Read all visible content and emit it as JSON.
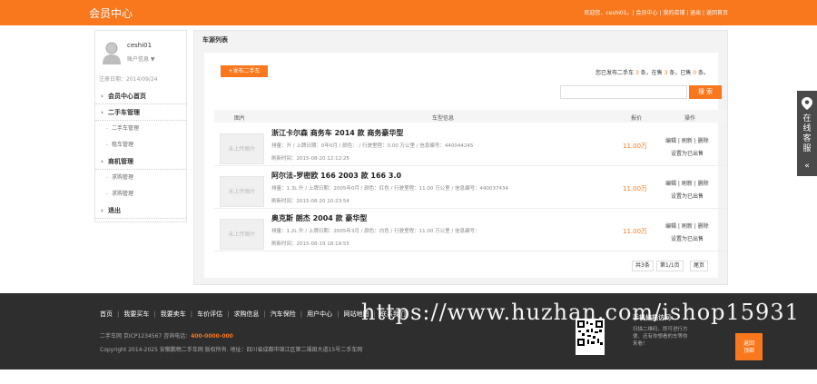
{
  "header": {
    "brand": "会员中心",
    "links": "欢迎您，ceshi01。| 会员中心 | 我的店铺 | 退出 | 返回首页"
  },
  "sidebar": {
    "username": "ceshi01",
    "account_info": "账户信息 ▼",
    "reg_date": "注册日期：2014/09/24",
    "items": [
      {
        "label": "会员中心首页",
        "type": "hd"
      },
      {
        "label": "二手车管理",
        "type": "hd"
      },
      {
        "label": "二手车管理",
        "type": "sub"
      },
      {
        "label": "租车管理",
        "type": "sub"
      },
      {
        "label": "商机管理",
        "type": "hd"
      },
      {
        "label": "求购管理",
        "type": "sub"
      },
      {
        "label": "求购管理",
        "type": "sub"
      },
      {
        "label": "退出",
        "type": "hd"
      }
    ]
  },
  "main": {
    "title": "车源列表",
    "publish_button": "+发布二手车",
    "summary": {
      "prefix": "您已发布二手车 ",
      "total": "3",
      "mid1": " 条，在售 ",
      "on_sale": "3",
      "mid2": " 条，已售 ",
      "sold": "0",
      "suffix": " 条。"
    },
    "search_placeholder": "",
    "search_button": "搜 索",
    "columns": {
      "photo": "图片",
      "model": "车型信息",
      "price": "报价",
      "ops": "操作"
    },
    "rows": [
      {
        "thumb": "未上传图片",
        "title": "浙江卡尔森 商务车 2014 款 商务豪华型",
        "spec": "排量：升 / 上牌日期：0年0月 / 颜色： / 行驶里程：0.00 万公里 / 信息编号：440044245",
        "date": "刷新时间：2015-08-20 12:12:25",
        "price": "11.00万",
        "ops1": "编辑 | 刷新 | 删除",
        "ops2": "设置为已出售"
      },
      {
        "thumb": "未上传图片",
        "title": "阿尔法-罗密欧 166 2003 款 166 3.0",
        "spec": "排量：1.3L 升 / 上牌日期：2005年0月 / 颜色：红色 / 行驶里程：11.00 万公里 / 信息编号：440037434",
        "date": "刷新时间：2015-08-20 10:23:54",
        "price": "11.00万",
        "ops1": "编辑 | 刷新 | 删除",
        "ops2": "设置为已出售"
      },
      {
        "thumb": "未上传图片",
        "title": "奥克斯 朗杰 2004 款 豪华型",
        "spec": "排量：1.2L 升 / 上牌日期：2005年3月 / 颜色：白色 / 行驶里程：11.00 万公里 / 信息编号：",
        "date": "刷新时间：2015-08-19 18:19:55",
        "price": "11.00万",
        "ops1": "编辑 | 刷新 | 删除",
        "ops2": "设置为已出售"
      }
    ],
    "pager": {
      "total": "共3条",
      "page": "第1/1页",
      "last": "尾页"
    }
  },
  "float_tab": {
    "text": "在线客服",
    "chevron": "«"
  },
  "footer": {
    "nav": [
      "首页",
      "我要买车",
      "我要卖车",
      "车价评估",
      "求购信息",
      "汽车保险",
      "用户中心",
      "网站地图",
      "联系我们"
    ],
    "icp": "二手车网  京ICP1234567  咨询电话：",
    "phone": "400-0000-000",
    "copyright": "Copyright 2014-2025 安徽鹏畅二手车网 版权所有.  地址：四川省成都市锦江区第二福田大道15号二手车网",
    "qr_title": "手机扫描访问",
    "qr_desc": "扫描二维码，即可进行方便、还有你想看的车等你来看！",
    "to_top": "返回\n顶部"
  },
  "watermark": "https://www.huzhan.com/ishop15931",
  "colors": {
    "accent": "#f9771d",
    "footer_bg": "#2e2e2e"
  }
}
